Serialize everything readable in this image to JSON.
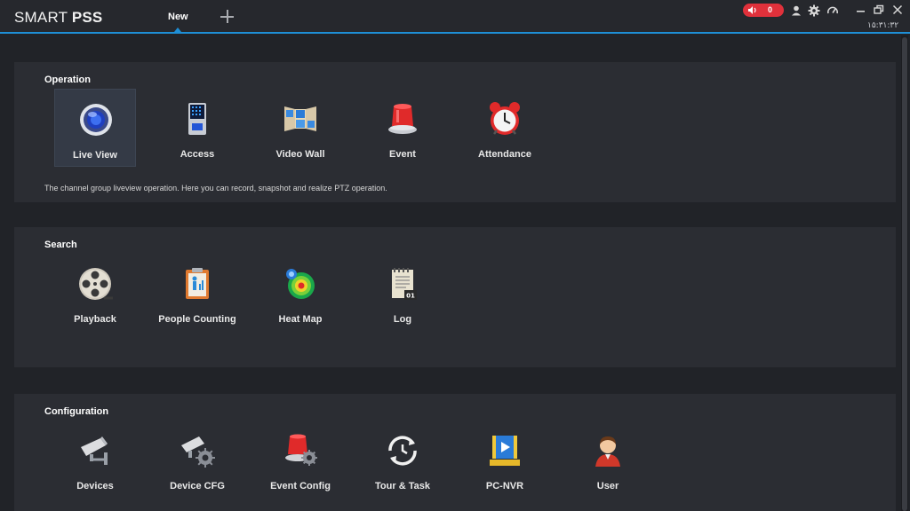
{
  "app": {
    "title_light": "SMART ",
    "title_bold": "PSS"
  },
  "tabs": [
    {
      "label": "New"
    }
  ],
  "header": {
    "alarm_count": "0",
    "clock": "۱۵:۳۱:۳۲"
  },
  "icons": {
    "speaker": "speaker-icon",
    "user": "user-icon",
    "settings": "gear-icon",
    "performance": "speedometer-icon",
    "minimize": "minimize-icon",
    "restore": "restore-icon",
    "close": "close-icon",
    "add_tab": "plus-icon"
  },
  "sections": {
    "operation": {
      "title": "Operation",
      "items": [
        {
          "label": "Live View",
          "icon": "camera-lens-icon"
        },
        {
          "label": "Access",
          "icon": "access-terminal-icon"
        },
        {
          "label": "Video Wall",
          "icon": "video-wall-icon"
        },
        {
          "label": "Event",
          "icon": "alarm-siren-icon"
        },
        {
          "label": "Attendance",
          "icon": "alarm-clock-icon"
        }
      ],
      "description": "The channel group liveview operation. Here you can record, snapshot and realize PTZ operation."
    },
    "search": {
      "title": "Search",
      "items": [
        {
          "label": "Playback",
          "icon": "film-reel-icon"
        },
        {
          "label": "People Counting",
          "icon": "people-counting-icon"
        },
        {
          "label": "Heat Map",
          "icon": "heat-map-icon"
        },
        {
          "label": "Log",
          "icon": "log-notepad-icon"
        }
      ]
    },
    "configuration": {
      "title": "Configuration",
      "items": [
        {
          "label": "Devices",
          "icon": "cctv-camera-icon"
        },
        {
          "label": "Device CFG",
          "icon": "camera-gear-icon"
        },
        {
          "label": "Event Config",
          "icon": "siren-gear-icon"
        },
        {
          "label": "Tour & Task",
          "icon": "refresh-clock-icon"
        },
        {
          "label": "PC-NVR",
          "icon": "pc-nvr-icon"
        },
        {
          "label": "User",
          "icon": "user-avatar-icon"
        }
      ]
    }
  },
  "colors": {
    "accent": "#1e8fd6",
    "alarm": "#e0313b",
    "panel": "#2b2d33",
    "background": "#212328"
  }
}
